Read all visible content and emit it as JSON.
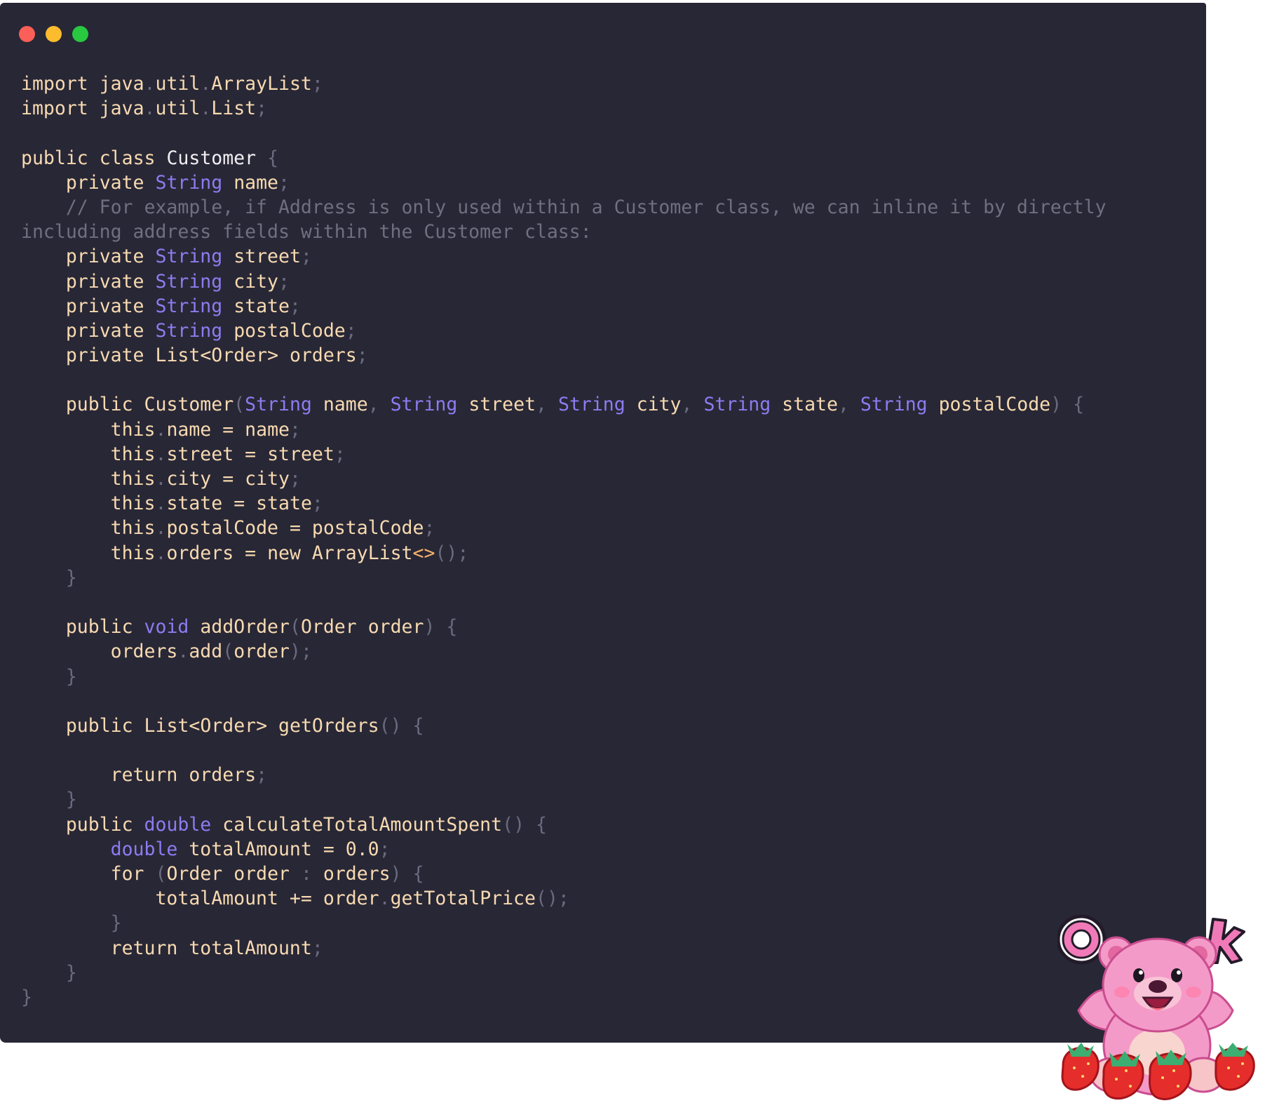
{
  "window": {
    "controls": {
      "close": "close-dot",
      "minimize": "minimize-dot",
      "maximize": "maximize-dot",
      "colors": {
        "close": "#fb5f57",
        "minimize": "#fdbc2e",
        "maximize": "#28c840"
      }
    },
    "theme": {
      "background": "#282736",
      "keyword": "#f7dab0",
      "type": "#8c7cf0",
      "comment": "#6f6f80",
      "punctuation": "#6b6a7e"
    }
  },
  "code": {
    "language": "Java",
    "lines": [
      "import java.util.ArrayList;",
      "import java.util.List;",
      "",
      "public class Customer {",
      "    private String name;",
      "    // For example, if Address is only used within a Customer class, we can inline it by directly",
      "including address fields within the Customer class:",
      "    private String street;",
      "    private String city;",
      "    private String state;",
      "    private String postalCode;",
      "    private List<Order> orders;",
      "",
      "    public Customer(String name, String street, String city, String state, String postalCode) {",
      "        this.name = name;",
      "        this.street = street;",
      "        this.city = city;",
      "        this.state = state;",
      "        this.postalCode = postalCode;",
      "        this.orders = new ArrayList<>();",
      "    }",
      "",
      "    public void addOrder(Order order) {",
      "        orders.add(order);",
      "    }",
      "",
      "    public List<Order> getOrders() {",
      "",
      "        return orders;",
      "    }",
      "    public double calculateTotalAmountSpent() {",
      "        double totalAmount = 0.0;",
      "        for (Order order : orders) {",
      "            totalAmount += order.getTotalPrice();",
      "        }",
      "        return totalAmount;",
      "    }",
      "}"
    ]
  },
  "sticker": {
    "icon": "pink-bear-ok-sticker",
    "text": "Ok"
  }
}
